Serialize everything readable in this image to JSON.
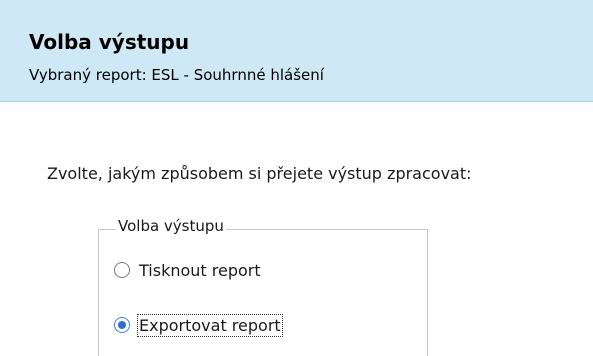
{
  "header": {
    "title": "Volba výstupu",
    "subtitle": "Vybraný report: ESL - Souhrnné hlášení",
    "background_color": "#cfe8f5"
  },
  "instruction": "Zvolte, jakým způsobem si přejete výstup zpracovat:",
  "output_group": {
    "legend": "Volba výstupu",
    "options": [
      {
        "label": "Tisknout report",
        "selected": false
      },
      {
        "label": "Exportovat report",
        "selected": true,
        "focused": true
      }
    ]
  },
  "colors": {
    "radio_selected": "#2f6fd0"
  }
}
